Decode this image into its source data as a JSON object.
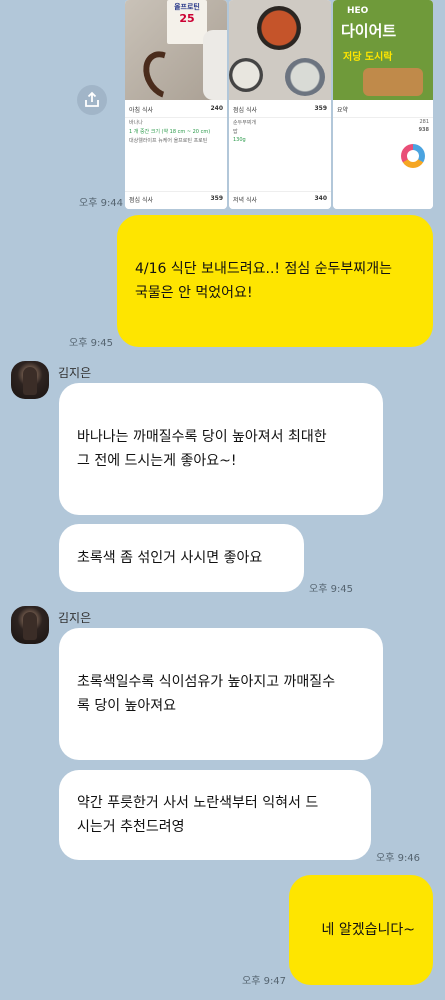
{
  "photos": {
    "panel1": {
      "meal_title": "아침 식사",
      "kcal": "240",
      "rows": [
        "바나나",
        "1 개 중간 크기 (약 18 cm ~ 20 cm)",
        "대상웰라이프 뉴케어 올프로틴 프로틴"
      ],
      "brand_text": "올프로틴",
      "brand_num": "25",
      "footer_label": "점심 식사",
      "footer_kcal": "359"
    },
    "panel2": {
      "meal_title": "점심 식사",
      "kcal": "359",
      "rows": [
        "순두부찌개",
        "밥",
        "130g"
      ],
      "footer_label": "저녁 식사",
      "footer_kcal": "340"
    },
    "panel3": {
      "brand_small": "HEO",
      "brand_big": "다이어트",
      "brand_sub": "저당 도시락",
      "summary_title": "요약",
      "summary_values": [
        "281",
        "938"
      ]
    }
  },
  "messages": [
    {
      "id": "m1_time",
      "text": "오후 9:44"
    },
    {
      "id": "m2",
      "lines": [
        "4/16 식단 보내드려요..! 점심 순두부찌개는",
        "국물은 안 먹었어요!"
      ],
      "time": "오후 9:45"
    },
    {
      "id": "s1",
      "sender": "김지은"
    },
    {
      "id": "m3",
      "lines": [
        "바나나는 까매질수록 당이 높아져서 최대한",
        "그 전에 드시는게 좋아요~!"
      ]
    },
    {
      "id": "m4",
      "lines": [
        "초록색 좀 섞인거 사시면 좋아요"
      ],
      "time": "오후 9:45"
    },
    {
      "id": "s2",
      "sender": "김지은"
    },
    {
      "id": "m5",
      "lines": [
        "초록색일수록 식이섬유가 높아지고 까매질수",
        "록 당이 높아져요"
      ]
    },
    {
      "id": "m6",
      "lines": [
        "약간 푸릇한거 사서 노란색부터 익혀서 드",
        "시는거 추천드려영"
      ],
      "time": "오후 9:46"
    },
    {
      "id": "m7",
      "lines": [
        "네 알겠습니다~"
      ],
      "time": "오후 9:47"
    }
  ],
  "colors": {
    "bg": "#b2c7d9",
    "me_bubble": "#fee500",
    "them_bubble": "#ffffff"
  },
  "icons": {
    "share": "share-icon"
  }
}
